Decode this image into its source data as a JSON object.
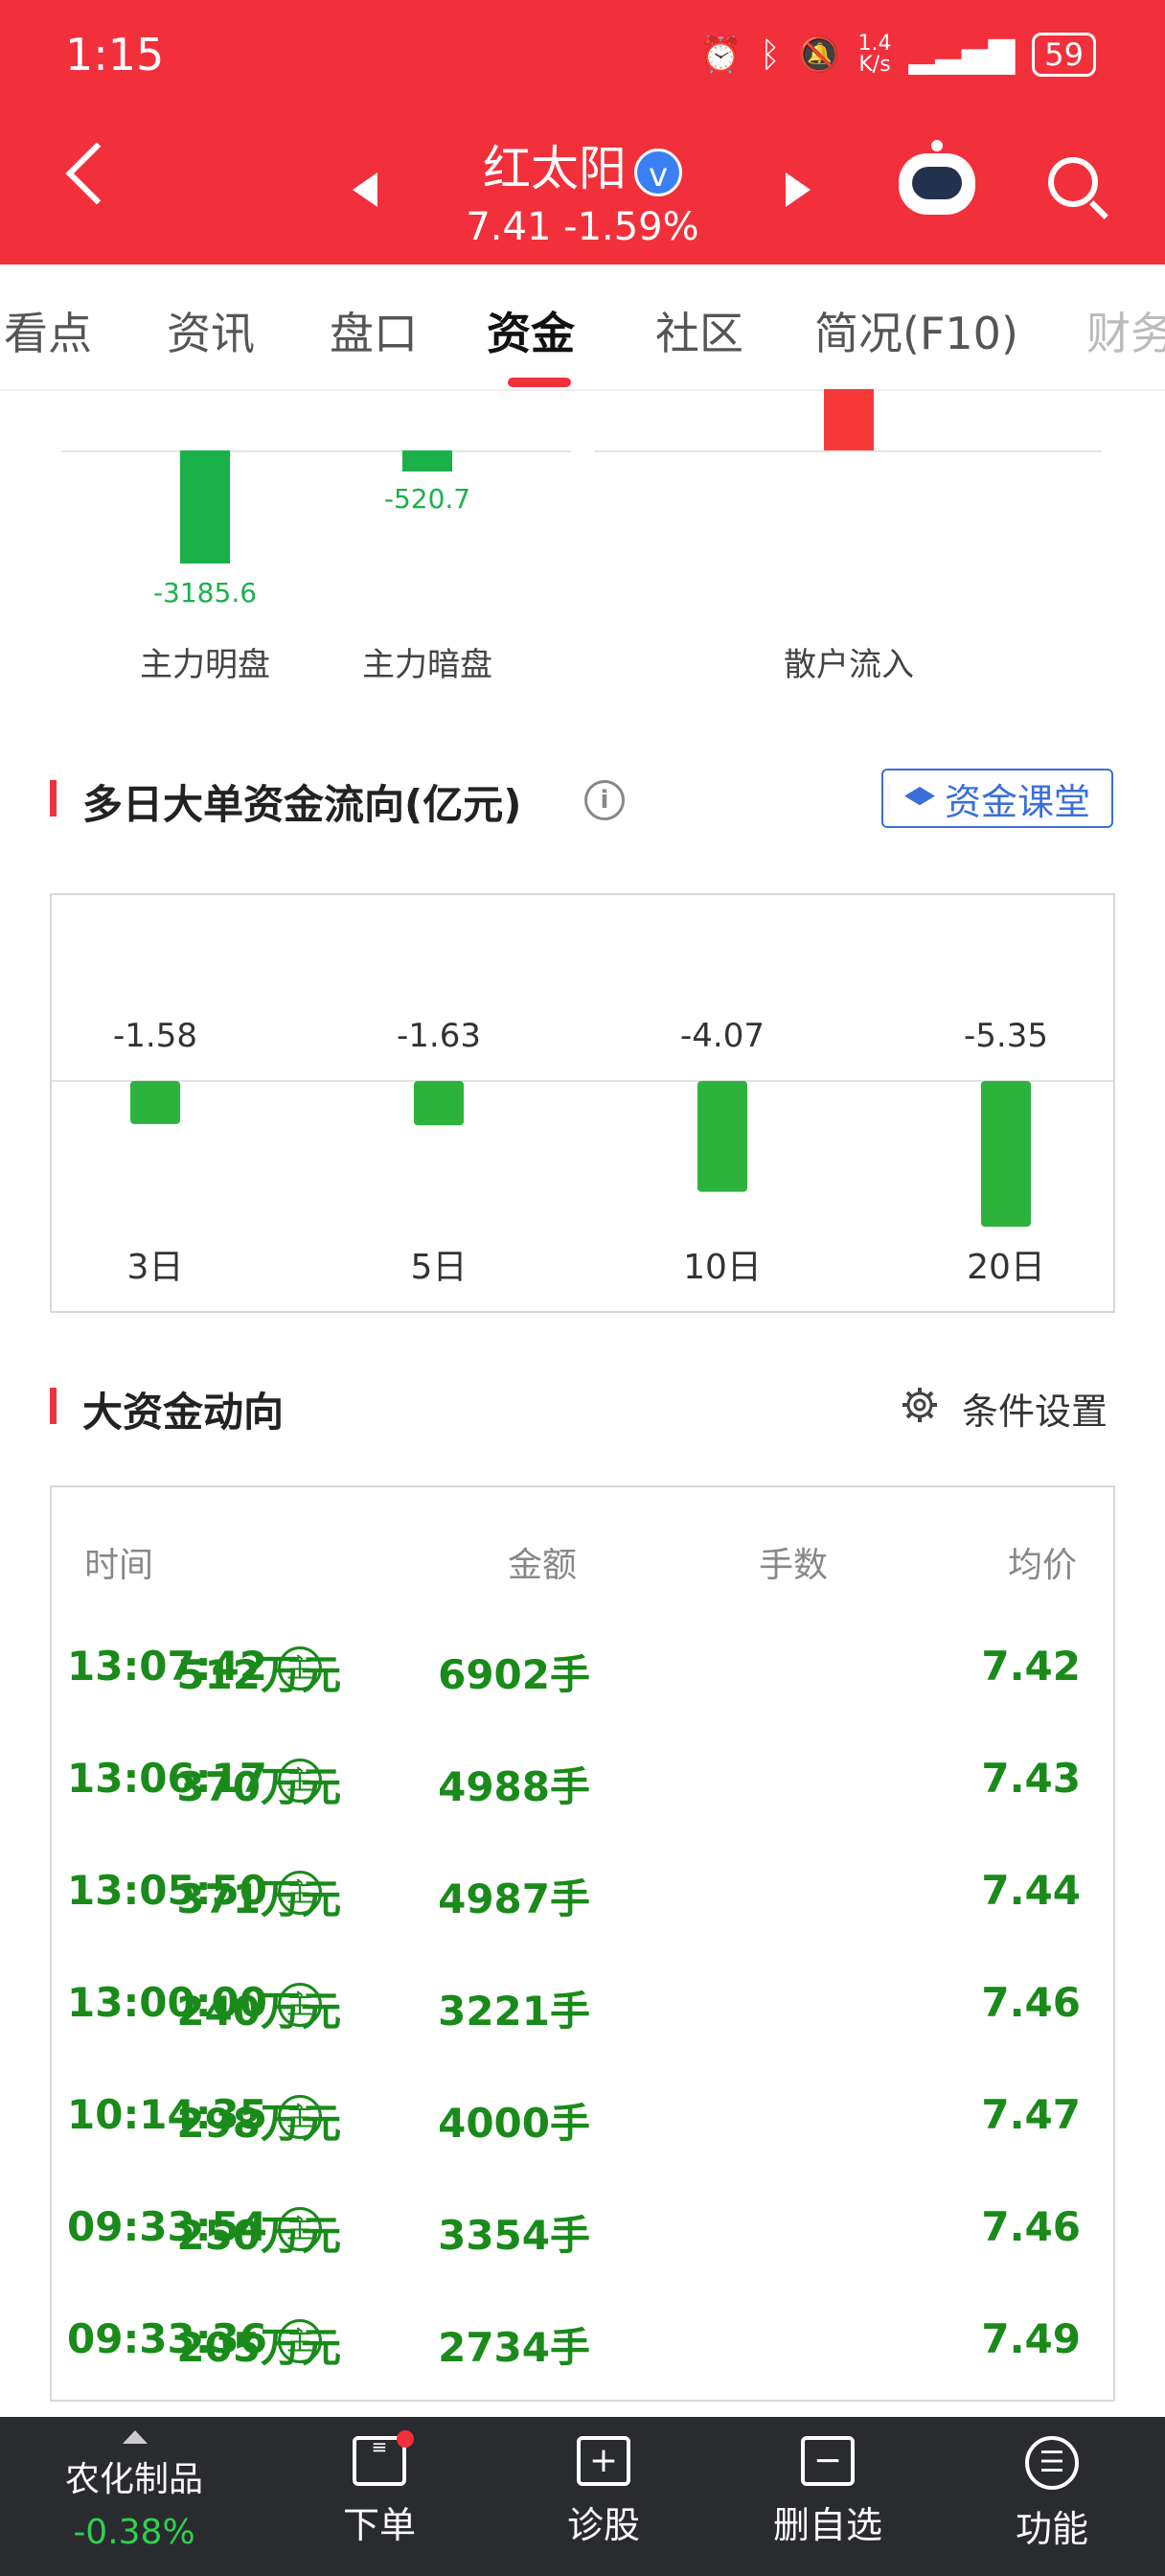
{
  "status": {
    "time": "1:15",
    "net_speed_top": "1.4",
    "net_speed_bottom": "K/s",
    "battery": "59"
  },
  "header": {
    "stock_name": "红太阳",
    "verified_mark": "v",
    "price_line": "7.41 -1.59%"
  },
  "tabs": [
    {
      "label": "看点"
    },
    {
      "label": "资讯"
    },
    {
      "label": "盘口"
    },
    {
      "label": "资金",
      "active": true
    },
    {
      "label": "社区"
    },
    {
      "label": "简况(F10)"
    },
    {
      "label": "财务"
    }
  ],
  "flow_summary": {
    "items": [
      {
        "label": "主力明盘",
        "value": "-3185.6"
      },
      {
        "label": "主力暗盘",
        "value": "-520.7"
      },
      {
        "label": "散户流入",
        "value": ""
      }
    ]
  },
  "multi_day": {
    "title": "多日大单资金流向(亿元)",
    "info_mark": "i",
    "class_button": "资金课堂",
    "chart_data": {
      "type": "bar",
      "categories": [
        "3日",
        "5日",
        "10日",
        "20日"
      ],
      "values": [
        -1.58,
        -1.63,
        -4.07,
        -5.35
      ],
      "value_labels": [
        "-1.58",
        "-1.63",
        "-4.07",
        "-5.35"
      ],
      "title": "多日大单资金流向(亿元)",
      "xlabel": "",
      "ylabel": "",
      "ylim": [
        -5.35,
        0
      ],
      "grid": false,
      "bar_color": "#2db33d"
    }
  },
  "big_funds": {
    "title": "大资金动向",
    "settings_label": "条件设置",
    "headers": {
      "time": "时间",
      "amount": "金额",
      "lots": "手数",
      "avg_price": "均价"
    },
    "badge": "主",
    "rows": [
      {
        "time": "13:07:42",
        "amount": "512万元",
        "lots": "6902手",
        "avg_price": "7.42"
      },
      {
        "time": "13:06:17",
        "amount": "370万元",
        "lots": "4988手",
        "avg_price": "7.43"
      },
      {
        "time": "13:05:50",
        "amount": "371万元",
        "lots": "4987手",
        "avg_price": "7.44"
      },
      {
        "time": "13:00:00",
        "amount": "240万元",
        "lots": "3221手",
        "avg_price": "7.46"
      },
      {
        "time": "10:14:35",
        "amount": "298万元",
        "lots": "4000手",
        "avg_price": "7.47"
      },
      {
        "time": "09:33:54",
        "amount": "250万元",
        "lots": "3354手",
        "avg_price": "7.46"
      },
      {
        "time": "09:33:36",
        "amount": "205万元",
        "lots": "2734手",
        "avg_price": "7.49"
      }
    ],
    "color": "#1a8a1a"
  },
  "bottom_bar": {
    "sector": "农化制品",
    "sector_change": "-0.38%",
    "items": [
      {
        "label": "下单",
        "icon": "order-icon"
      },
      {
        "label": "诊股",
        "icon": "diagnose-icon",
        "glyph": "+"
      },
      {
        "label": "删自选",
        "icon": "remove-watchlist-icon",
        "glyph": "−"
      },
      {
        "label": "功能",
        "icon": "menu-icon",
        "glyph": "☰"
      }
    ]
  },
  "colors": {
    "brand_red": "#f2303b",
    "down_green": "#1ab14b",
    "up_red": "#f63a3a",
    "accent_blue": "#3b6fd8"
  }
}
